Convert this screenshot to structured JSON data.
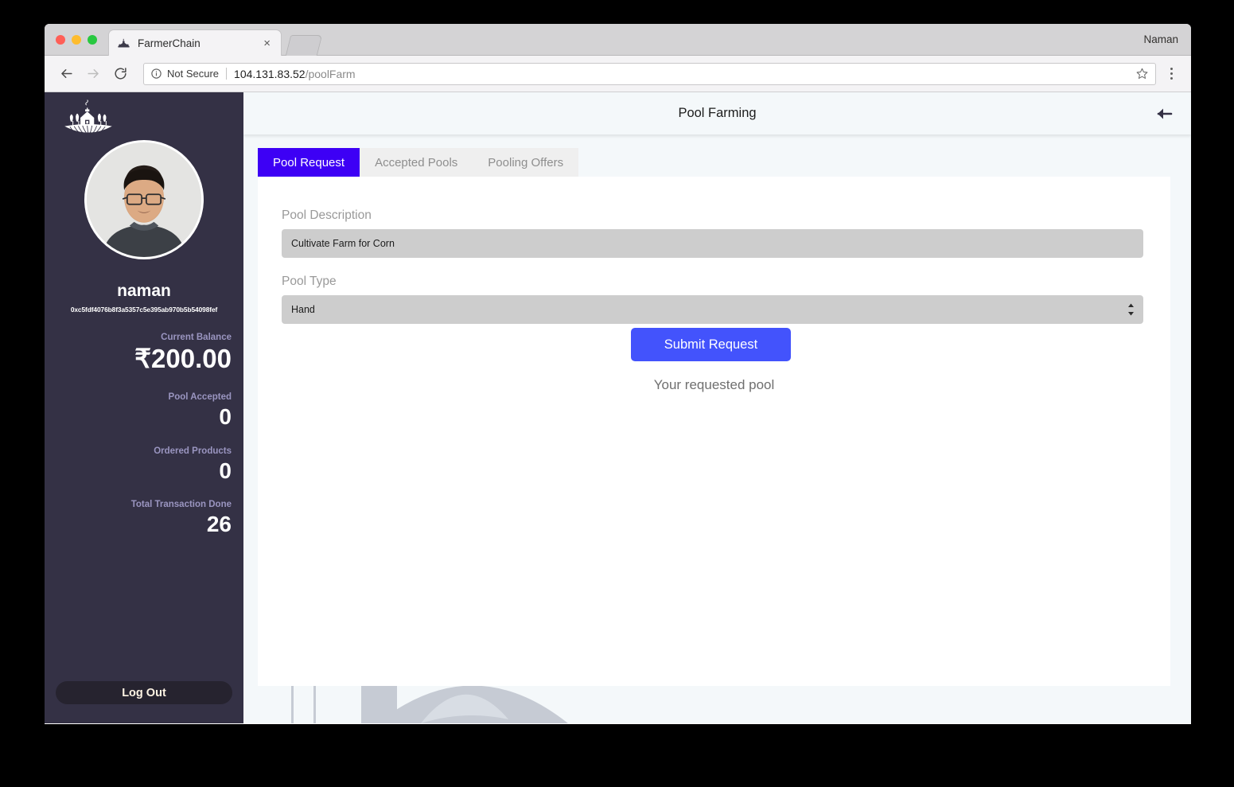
{
  "browser": {
    "tab_title": "FarmerChain",
    "tab_favicon_name": "farmerchain-favicon",
    "close_label": "×",
    "window_user_label": "Naman",
    "security_label": "Not Secure",
    "url_host": "104.131.83.52",
    "url_path": "/poolFarm",
    "icons": {
      "back": "back-arrow-icon",
      "forward": "forward-arrow-icon",
      "reload": "reload-icon",
      "info": "info-circle-icon",
      "bookmark": "star-icon",
      "menu": "three-dot-menu-icon"
    }
  },
  "sidebar": {
    "logo_name": "farm-logo",
    "avatar_name": "user-avatar",
    "user_name": "naman",
    "wallet_address": "0xc5fdf4076b8f3a5357c5e395ab970b5b54098fef",
    "stats": [
      {
        "label": "Current Balance",
        "value": "₹200.00"
      },
      {
        "label": "Pool Accepted",
        "value": "0"
      },
      {
        "label": "Ordered Products",
        "value": "0"
      },
      {
        "label": "Total Transaction Done",
        "value": "26"
      }
    ],
    "logout_label": "Log Out"
  },
  "header": {
    "title": "Pool Farming",
    "back_icon_name": "back-arrow-icon"
  },
  "tabs": [
    {
      "label": "Pool Request",
      "active": true
    },
    {
      "label": "Accepted Pools",
      "active": false
    },
    {
      "label": "Pooling Offers",
      "active": false
    }
  ],
  "form": {
    "pool_description_label": "Pool Description",
    "pool_description_value": "Cultivate Farm for Corn",
    "pool_description_placeholder": "Pool Description",
    "pool_type_label": "Pool Type",
    "pool_type_value": "Hand",
    "pool_type_options": [
      "Hand"
    ],
    "submit_label": "Submit Request",
    "requested_pool_text": "Your requested pool"
  },
  "colors": {
    "sidebar_bg": "#343145",
    "accent_tab": "#3d00f5",
    "accent_button": "#4353fc",
    "stat_label": "#9a95c0",
    "page_bg": "#f4f8fa"
  }
}
